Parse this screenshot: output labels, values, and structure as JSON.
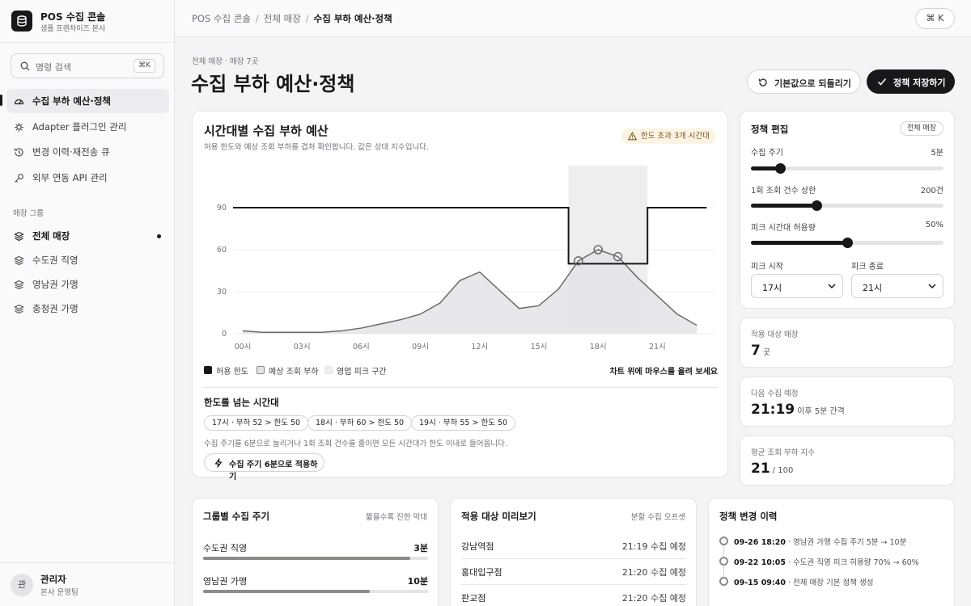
{
  "brand": {
    "title": "POS 수집 콘솔",
    "subtitle": "샘플 프랜차이즈 본사"
  },
  "search": {
    "placeholder": "명령 검색",
    "shortcut": "⌘K"
  },
  "nav": [
    {
      "label": "수집 부하 예산·정책",
      "icon": "gauge-icon",
      "active": true
    },
    {
      "label": "Adapter 플러그인 관리",
      "icon": "plug-icon"
    },
    {
      "label": "변경 이력·재전송 큐",
      "icon": "history-icon"
    },
    {
      "label": "외부 연동 API 관리",
      "icon": "key-icon"
    }
  ],
  "store_section": "매장 그룹",
  "stores": [
    {
      "label": "전체 매장",
      "icon": "layers-icon",
      "selected": true
    },
    {
      "label": "수도권 직영",
      "icon": "layers-icon"
    },
    {
      "label": "영남권 가맹",
      "icon": "layers-icon"
    },
    {
      "label": "충청권 가맹",
      "icon": "layers-icon"
    }
  ],
  "user": {
    "initial": "관",
    "name": "관리자",
    "role": "본사 운영팀"
  },
  "breadcrumb": [
    "POS 수집 콘솔",
    "전체 매장",
    "수집 부하 예산·정책"
  ],
  "topbar": {
    "cmd_key_label": "⌘ K"
  },
  "page": {
    "kicker": "전체 매장 · 매장 7곳",
    "title": "수집 부하 예산·정책",
    "reset_label": "기본값으로 되돌리기",
    "save_label": "정책 저장하기"
  },
  "chart_card": {
    "title": "시간대별 수집 부하 예산",
    "subtitle": "허용 한도와 예상 조회 부하를 겹쳐 확인합니다. 값은 상대 지수입니다.",
    "warning_badge": "한도 초과 3개 시간대",
    "legend": [
      "허용 한도",
      "예상 조회 부하",
      "영업 피크 구간"
    ],
    "hover_hint": "차트 위에 마우스를 올려 보세요",
    "over_title": "한도를 넘는 시간대",
    "over_chips": [
      "17시 · 부하 52 > 한도 50",
      "18시 · 부하 60 > 한도 50",
      "19시 · 부하 55 > 한도 50"
    ],
    "over_note": "수집 주기를 6분으로 늘리거나 1회 조회 건수를 줄이면 모든 시간대가 한도 이내로 들어옵니다.",
    "apply_label": "수집 주기 6분으로 적용하기"
  },
  "chart_data": {
    "type": "area",
    "x": [
      0,
      1,
      2,
      3,
      4,
      5,
      6,
      7,
      8,
      9,
      10,
      11,
      12,
      13,
      14,
      15,
      16,
      17,
      18,
      19,
      20,
      21,
      22,
      23
    ],
    "x_ticks": [
      "00시",
      "03시",
      "06시",
      "09시",
      "12시",
      "15시",
      "18시",
      "21시"
    ],
    "x_tick_positions": [
      0,
      3,
      6,
      9,
      12,
      15,
      18,
      21
    ],
    "y_ticks": [
      0,
      30,
      60,
      90
    ],
    "ylim": [
      0,
      120
    ],
    "series": [
      {
        "name": "허용 한도",
        "type": "step-line",
        "values": [
          90,
          90,
          90,
          90,
          90,
          90,
          90,
          90,
          90,
          90,
          90,
          90,
          90,
          90,
          90,
          90,
          90,
          50,
          50,
          50,
          90,
          90,
          90,
          90
        ]
      },
      {
        "name": "예상 조회 부하",
        "type": "area",
        "values": [
          2,
          1,
          1,
          1,
          1,
          2,
          4,
          7,
          10,
          14,
          22,
          38,
          44,
          31,
          18,
          20,
          32,
          52,
          60,
          55,
          40,
          27,
          14,
          6
        ]
      }
    ],
    "peak_band": {
      "from": 16.5,
      "to": 20.5
    },
    "over_points": [
      17,
      18,
      19
    ],
    "colors": {
      "limit": "#18181b",
      "load_line": "#6b6b6b",
      "load_fill": "#e4e4e7",
      "peak": "#eeeeee"
    }
  },
  "policy": {
    "title": "정책 편집",
    "scope_badge": "전체 매장",
    "sliders": [
      {
        "label": "수집 주기",
        "value_label": "5분",
        "fraction": 0.15
      },
      {
        "label": "1회 조회 건수 상한",
        "value_label": "200건",
        "fraction": 0.34
      },
      {
        "label": "피크 시간대 허용량",
        "value_label": "50%",
        "fraction": 0.5
      }
    ],
    "peak_start_label": "피크 시작",
    "peak_start_value": "17시",
    "peak_end_label": "피크 종료",
    "peak_end_value": "21시"
  },
  "stats": {
    "target_label": "적용 대상 매장",
    "target_value": "7",
    "target_unit": "곳",
    "next_label": "다음 수집 예정",
    "next_value": "21:19",
    "next_unit": "이후 5분 간격",
    "avg_label": "평균 조회 부하 지수",
    "avg_value": "21",
    "avg_unit": "/ 100"
  },
  "groups_card": {
    "title": "그룹별 수집 주기",
    "aside": "짧을수록 진한 막대",
    "rows": [
      {
        "name": "수도권 직영",
        "value": "3분",
        "fraction": 0.92
      },
      {
        "name": "영남권 가맹",
        "value": "10분",
        "fraction": 0.74
      }
    ]
  },
  "preview_card": {
    "title": "적용 대상 미리보기",
    "aside": "분할 수집 오프셋",
    "rows": [
      {
        "name": "강남역점",
        "time": "21:19 수집 예정"
      },
      {
        "name": "홍대입구점",
        "time": "21:20 수집 예정"
      },
      {
        "name": "판교점",
        "time": "21:20 수집 예정"
      }
    ]
  },
  "history_card": {
    "title": "정책 변경 이력",
    "items": [
      {
        "when": "09-26 18:20",
        "text": "· 영남권 가맹 수집 주기 5분 → 10분"
      },
      {
        "when": "09-22 10:05",
        "text": "· 수도권 직영 피크 허용량 70% → 60%"
      },
      {
        "when": "09-15 09:40",
        "text": "· 전체 매장 기본 정책 생성"
      }
    ]
  }
}
